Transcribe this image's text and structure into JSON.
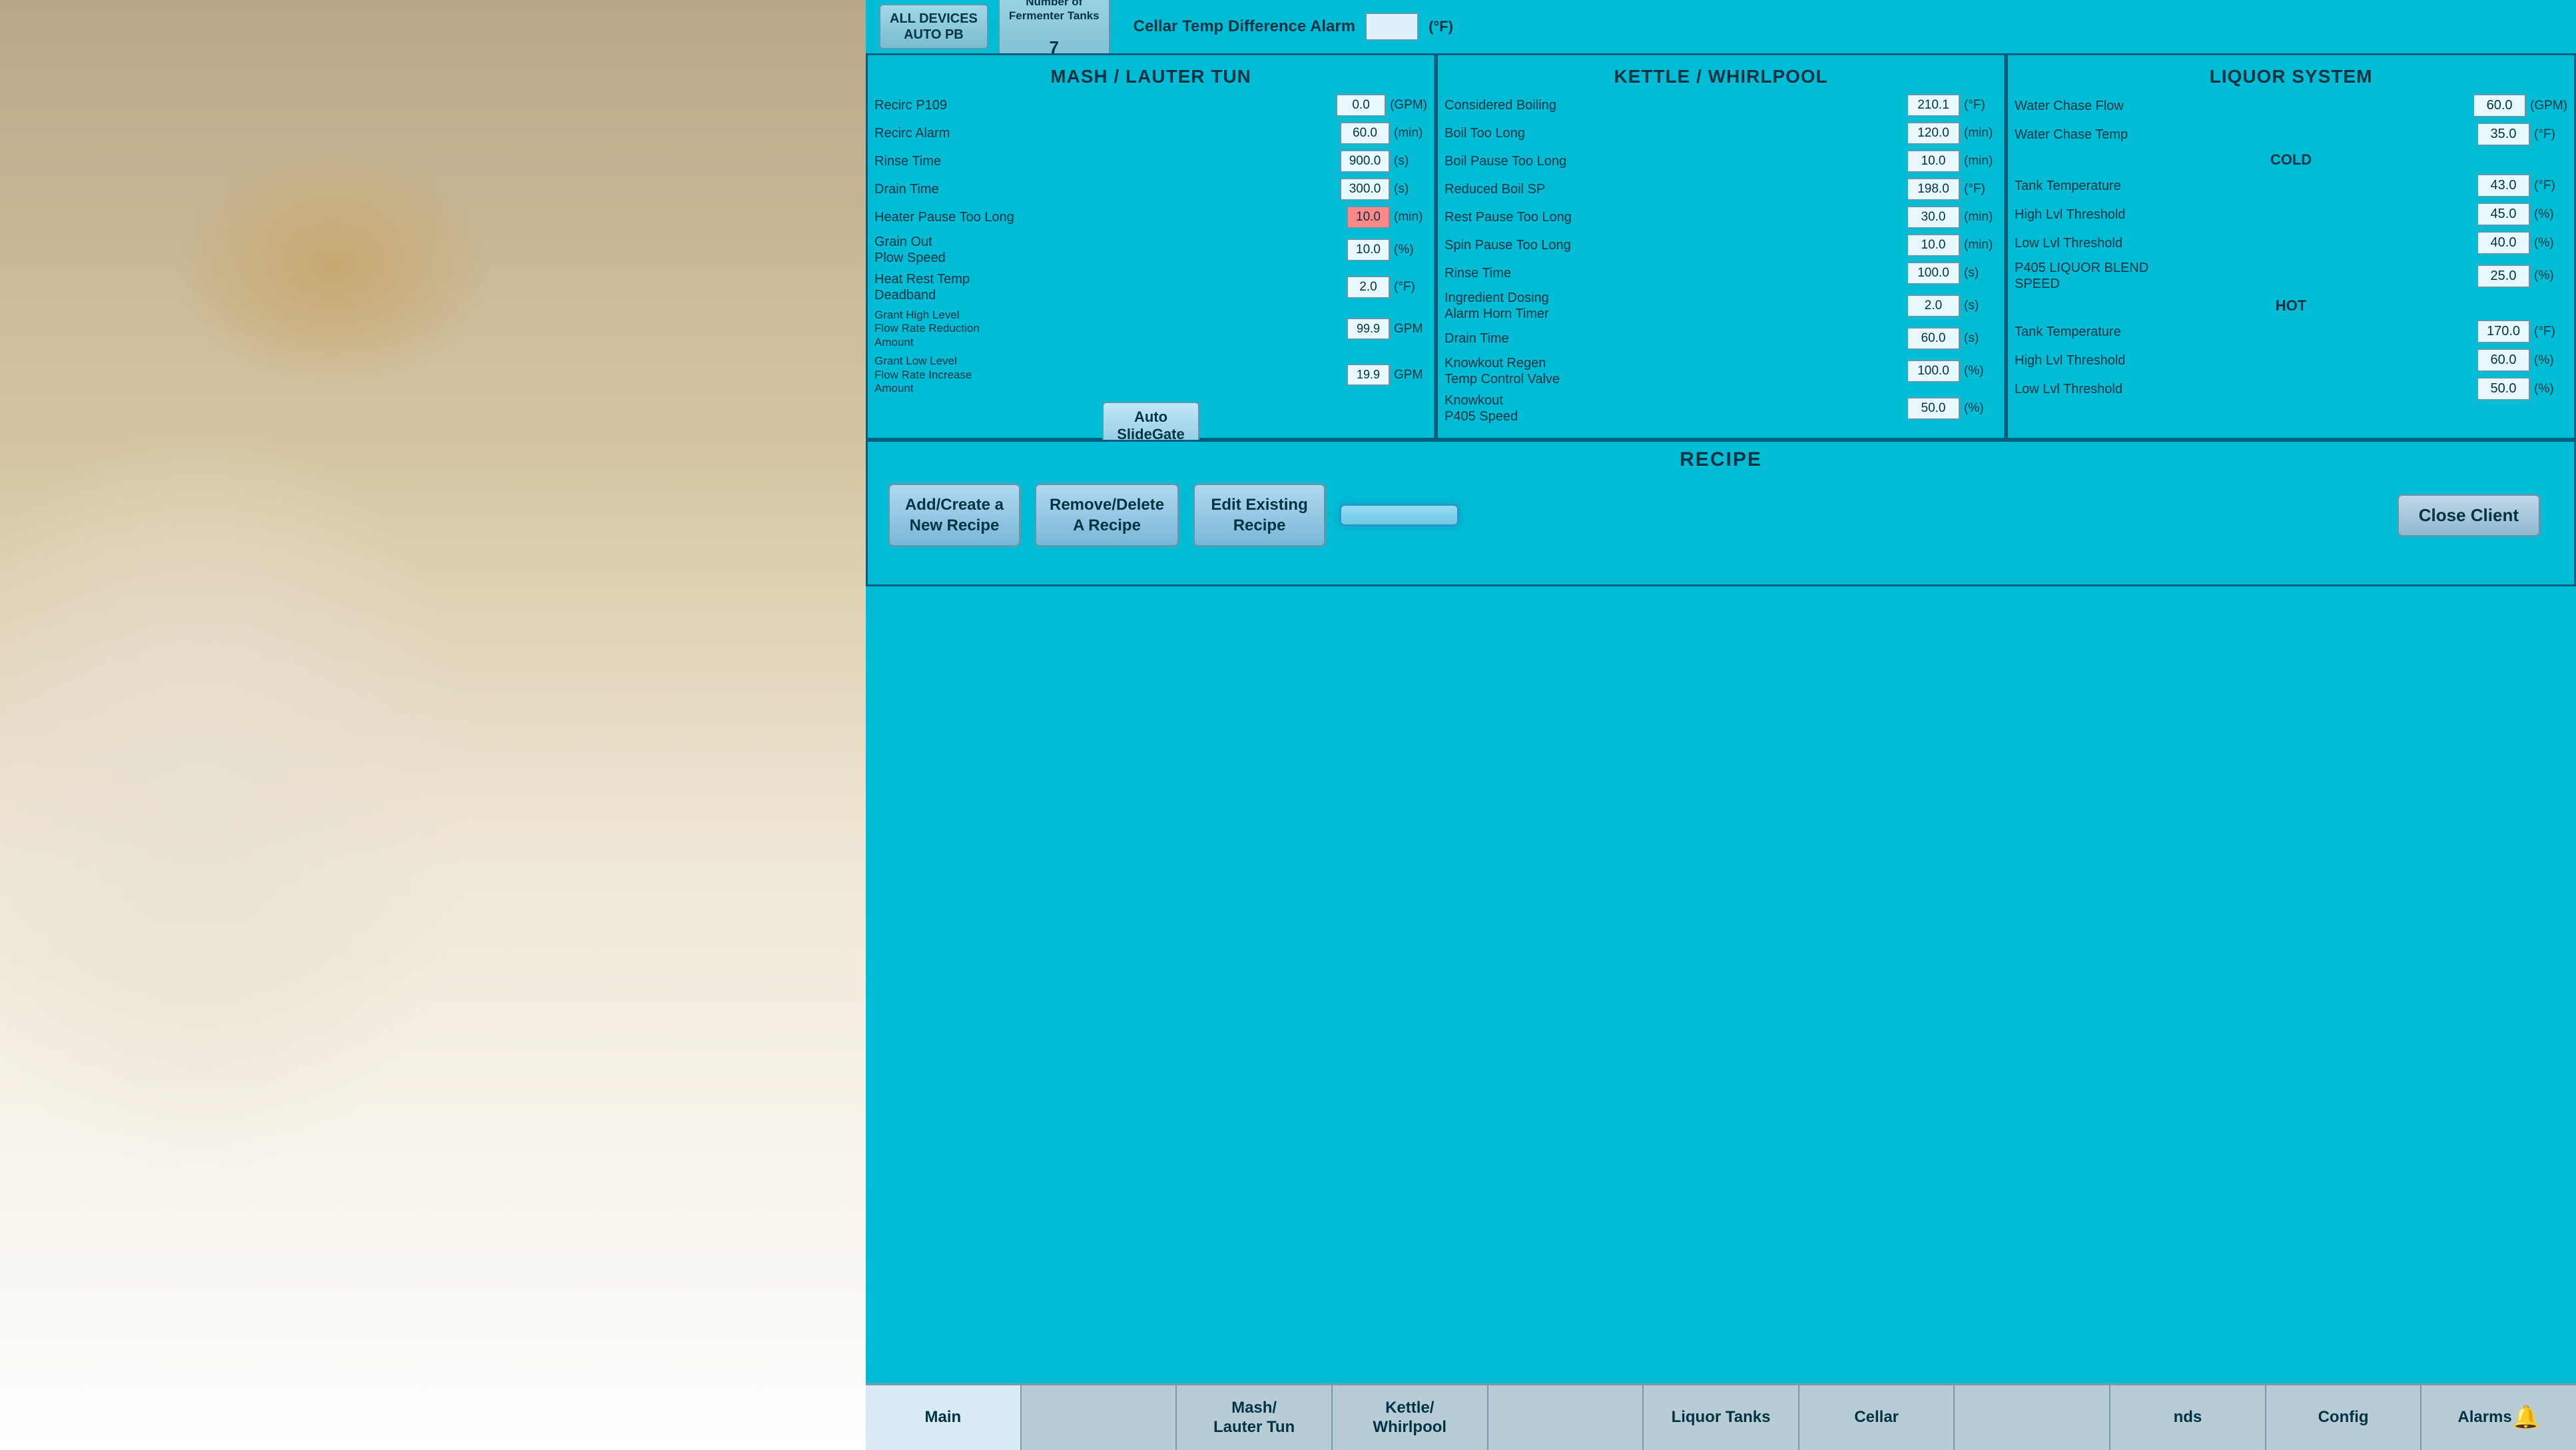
{
  "topBar": {
    "allDevicesBtn": "ALL DEVICES\nAUTO PB",
    "fermenterTanksLabel": "Number of\nFermenter Tanks",
    "fermenterTanksValue": "7",
    "cellarTempDiffLabel": "Cellar Temp Difference Alarm",
    "cellarTempDiffValue": "",
    "cellarTempDiffUnit": "(°F)"
  },
  "mashLauterTun": {
    "title": "MASH / LAUTER TUN",
    "fields": [
      {
        "label": "Recirc P109",
        "value": "0.0",
        "unit": "(GPM)"
      },
      {
        "label": "Recirc Alarm",
        "value": "60.0",
        "unit": "(min)"
      },
      {
        "label": "Rinse Time",
        "value": "900.0",
        "unit": "(s)"
      },
      {
        "label": "Drain Time",
        "value": "300.0",
        "unit": "(s)"
      },
      {
        "label": "Heater Pause Too Long",
        "value": "10.0",
        "unit": "(min)"
      },
      {
        "label": "Grain Out\nPlow Speed",
        "value": "10.0",
        "unit": "(%)"
      },
      {
        "label": "Heat Rest Temp\nDeadband",
        "value": "2.0",
        "unit": "(°F)"
      },
      {
        "label": "Grant High Level Flow Rate Reduction Amount",
        "value": "99.9",
        "unit": "GPM"
      },
      {
        "label": "Grant Low Level Flow Rate Increase Amount",
        "value": "19.9",
        "unit": "GPM"
      }
    ],
    "autoSlideGateBtn": "Auto\nSlideGate"
  },
  "kettleWhirlpool": {
    "title": "KETTLE / WHIRLPOOL",
    "fields": [
      {
        "label": "Considered Boiling",
        "value": "210.1",
        "unit": "(°F)"
      },
      {
        "label": "Boil Too Long",
        "value": "120.0",
        "unit": "(min)"
      },
      {
        "label": "Boil Pause Too Long",
        "value": "10.0",
        "unit": "(min)"
      },
      {
        "label": "Reduced Boil SP",
        "value": "198.0",
        "unit": "(°F)"
      },
      {
        "label": "Rest Pause Too Long",
        "value": "30.0",
        "unit": "(min)"
      },
      {
        "label": "Spin Pause Too Long",
        "value": "10.0",
        "unit": "(min)"
      },
      {
        "label": "Rinse Time",
        "value": "100.0",
        "unit": "(s)"
      },
      {
        "label": "Ingredient Dosing Alarm Horn Timer",
        "value": "2.0",
        "unit": "(s)"
      },
      {
        "label": "Drain Time",
        "value": "60.0",
        "unit": "(s)"
      },
      {
        "label": "Knowkout Regen Temp Control Valve",
        "value": "100.0",
        "unit": "(%)"
      },
      {
        "label": "Knowkout\nP405 Speed",
        "value": "50.0",
        "unit": "(%)"
      }
    ]
  },
  "liquorSystem": {
    "title": "LIQUOR SYSTEM",
    "waterChaseFlow": {
      "label": "Water Chase Flow",
      "value": "60.0",
      "unit": "(GPM)"
    },
    "waterChaseTemp": {
      "label": "Water Chase Temp",
      "value": "35.0",
      "unit": "(°F)"
    },
    "coldTitle": "COLD",
    "coldFields": [
      {
        "label": "Tank Temperature",
        "value": "43.0",
        "unit": "(°F)"
      },
      {
        "label": "High Lvl Threshold",
        "value": "45.0",
        "unit": "(%)"
      },
      {
        "label": "Low Lvl Threshold",
        "value": "40.0",
        "unit": "(%)"
      },
      {
        "label": "P405 LIQUOR BLEND SPEED",
        "value": "25.0",
        "unit": "(%)"
      }
    ],
    "hotTitle": "HOT",
    "hotFields": [
      {
        "label": "Tank Temperature",
        "value": "170.0",
        "unit": "(°F)"
      },
      {
        "label": "High Lvl Threshold",
        "value": "60.0",
        "unit": "(%)"
      },
      {
        "label": "Low Lvl Threshold",
        "value": "50.0",
        "unit": "(%)"
      }
    ]
  },
  "recipe": {
    "title": "RECIPE",
    "buttons": [
      {
        "label": "Add/Create a\nNew Recipe",
        "active": false
      },
      {
        "label": "Remove/Delete\nA Recipe",
        "active": false
      },
      {
        "label": "Edit Existing\nRecipe",
        "active": false
      },
      {
        "label": "",
        "active": true
      }
    ],
    "closeClientBtn": "Close Client"
  },
  "bottomNav": [
    {
      "label": "Main",
      "active": true
    },
    {
      "label": ""
    },
    {
      "label": "Mash/\nLauter Tun"
    },
    {
      "label": "Kettle/\nWhirlpool"
    },
    {
      "label": ""
    },
    {
      "label": "Liquor Tanks"
    },
    {
      "label": "Cellar"
    },
    {
      "label": ""
    },
    {
      "label": "nds"
    },
    {
      "label": "Config"
    },
    {
      "label": "Alarms",
      "icon": "🔔"
    }
  ]
}
